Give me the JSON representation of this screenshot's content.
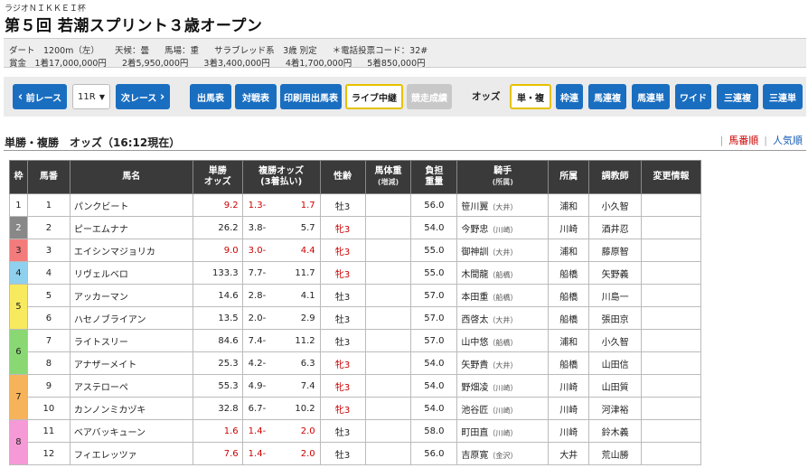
{
  "sponsor": "ラジオＮＩＫＫＥＩ杯",
  "title": "第５回 若潮スプリント３歳オープン",
  "info": {
    "row1": [
      "ダート　1200m（左）",
      "天候：曇",
      "馬場：重",
      "サラブレッド系　3歳 別定",
      "＊電話投票コード：32#"
    ],
    "row2": [
      "賞金　1着17,000,000円",
      "2着5,950,000円",
      "3着3,400,000円",
      "4着1,700,000円",
      "5着850,000円"
    ]
  },
  "nav": {
    "prev": "前レース",
    "race_select": "11R",
    "next": "次レース",
    "buttons": [
      "出馬表",
      "対戦表",
      "印刷用出馬表",
      "ライブ中継",
      "競走成績"
    ],
    "odds_label": "オッズ",
    "odds_buttons": [
      "単・複",
      "枠連",
      "馬連複",
      "馬連単",
      "ワイド",
      "三連複",
      "三連単"
    ]
  },
  "section": {
    "title": "単勝・複勝　オッズ（16:12現在）",
    "sort_active": "馬番順",
    "sort_link": "人気順"
  },
  "table": {
    "headers": {
      "waku": "枠",
      "umaban": "馬番",
      "name": "馬名",
      "win1": "単勝",
      "win2": "オッズ",
      "place1": "複勝オッズ",
      "place2": "(3着払い)",
      "sex": "性齢",
      "weight1": "馬体重",
      "weight2": "(増減)",
      "burden1": "負担",
      "burden2": "重量",
      "jockey1": "騎手",
      "jockey2": "(所属)",
      "stable": "所属",
      "trainer": "調教師",
      "change": "変更情報"
    },
    "rows": [
      {
        "waku": "1",
        "num": "1",
        "name": "パンクビート",
        "win": "9.2",
        "plo": "1.3-",
        "phi": "1.7",
        "sex": "牡3",
        "wt": "",
        "burden": "56.0",
        "jockey": "笹川翼",
        "aff": "（大井）",
        "stable": "浦和",
        "trainer": "小久智",
        "change": ""
      },
      {
        "waku": "2",
        "num": "2",
        "name": "ピーエムナナ",
        "win": "26.2",
        "plo": "3.8-",
        "phi": "5.7",
        "sex": "牝3",
        "wt": "",
        "burden": "54.0",
        "jockey": "今野忠",
        "aff": "（川崎）",
        "stable": "川崎",
        "trainer": "酒井忍",
        "change": ""
      },
      {
        "waku": "3",
        "num": "3",
        "name": "エイシンマジョリカ",
        "win": "9.0",
        "plo": "3.0-",
        "phi": "4.4",
        "sex": "牝3",
        "wt": "",
        "burden": "55.0",
        "jockey": "御神訓",
        "aff": "（大井）",
        "stable": "浦和",
        "trainer": "藤原智",
        "change": ""
      },
      {
        "waku": "4",
        "num": "4",
        "name": "リヴェルベロ",
        "win": "133.3",
        "plo": "7.7-",
        "phi": "11.7",
        "sex": "牝3",
        "wt": "",
        "burden": "55.0",
        "jockey": "木間龍",
        "aff": "（船橋）",
        "stable": "船橋",
        "trainer": "矢野義",
        "change": ""
      },
      {
        "waku": "5",
        "num": "5",
        "name": "アッカーマン",
        "win": "14.6",
        "plo": "2.8-",
        "phi": "4.1",
        "sex": "牡3",
        "wt": "",
        "burden": "57.0",
        "jockey": "本田重",
        "aff": "（船橋）",
        "stable": "船橋",
        "trainer": "川島一",
        "change": ""
      },
      {
        "waku": "",
        "num": "6",
        "name": "ハセノブライアン",
        "win": "13.5",
        "plo": "2.0-",
        "phi": "2.9",
        "sex": "牡3",
        "wt": "",
        "burden": "57.0",
        "jockey": "西啓太",
        "aff": "（大井）",
        "stable": "船橋",
        "trainer": "張田京",
        "change": ""
      },
      {
        "waku": "6",
        "num": "7",
        "name": "ライトスリー",
        "win": "84.6",
        "plo": "7.4-",
        "phi": "11.2",
        "sex": "牡3",
        "wt": "",
        "burden": "57.0",
        "jockey": "山中悠",
        "aff": "（船橋）",
        "stable": "浦和",
        "trainer": "小久智",
        "change": ""
      },
      {
        "waku": "",
        "num": "8",
        "name": "アナザーメイト",
        "win": "25.3",
        "plo": "4.2-",
        "phi": "6.3",
        "sex": "牝3",
        "wt": "",
        "burden": "54.0",
        "jockey": "矢野貴",
        "aff": "（大井）",
        "stable": "船橋",
        "trainer": "山田信",
        "change": ""
      },
      {
        "waku": "7",
        "num": "9",
        "name": "アステローペ",
        "win": "55.3",
        "plo": "4.9-",
        "phi": "7.4",
        "sex": "牝3",
        "wt": "",
        "burden": "54.0",
        "jockey": "野畑凌",
        "aff": "（川崎）",
        "stable": "川崎",
        "trainer": "山田質",
        "change": ""
      },
      {
        "waku": "",
        "num": "10",
        "name": "カンノンミカヅキ",
        "win": "32.8",
        "plo": "6.7-",
        "phi": "10.2",
        "sex": "牝3",
        "wt": "",
        "burden": "54.0",
        "jockey": "池谷匠",
        "aff": "（川崎）",
        "stable": "川崎",
        "trainer": "河津裕",
        "change": ""
      },
      {
        "waku": "8",
        "num": "11",
        "name": "ベアバッキューン",
        "win": "1.6",
        "plo": "1.4-",
        "phi": "2.0",
        "sex": "牡3",
        "wt": "",
        "burden": "58.0",
        "jockey": "町田直",
        "aff": "（川崎）",
        "stable": "川崎",
        "trainer": "鈴木義",
        "change": ""
      },
      {
        "waku": "",
        "num": "12",
        "name": "フィエレッツァ",
        "win": "7.6",
        "plo": "1.4-",
        "phi": "2.0",
        "sex": "牡3",
        "wt": "",
        "burden": "56.0",
        "jockey": "吉原寛",
        "aff": "（金沢）",
        "stable": "大井",
        "trainer": "荒山勝",
        "change": ""
      }
    ]
  },
  "colors": {
    "accent": "#1a6ec0",
    "odds_highlight": "#cc0000",
    "waku": [
      "#ffffff",
      "#888888",
      "#f37b7b",
      "#8fd0ee",
      "#f7ea5e",
      "#8ad874",
      "#f7b35a",
      "#f59ad6"
    ]
  }
}
